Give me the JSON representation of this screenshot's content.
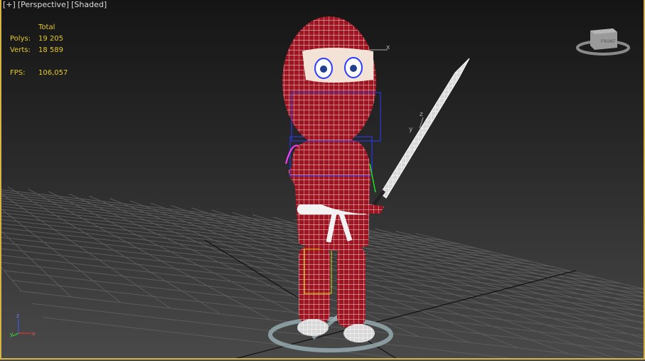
{
  "viewport": {
    "labels": [
      "[+]",
      "[Perspective]",
      "[Shaded]"
    ],
    "stats": {
      "header": "Total",
      "polys_label": "Polys:",
      "polys": "19 205",
      "verts_label": "Verts:",
      "verts": "18 589",
      "fps_label": "FPS:",
      "fps": "106,057"
    },
    "viewcube_face": "FRONT",
    "gizmo_axes": {
      "x": "x",
      "y": "y",
      "z": "z"
    },
    "colors": {
      "border": "#d7b545",
      "stats": "#e6c82a",
      "mesh": "#a3131c",
      "wire": "#ffffff"
    }
  }
}
